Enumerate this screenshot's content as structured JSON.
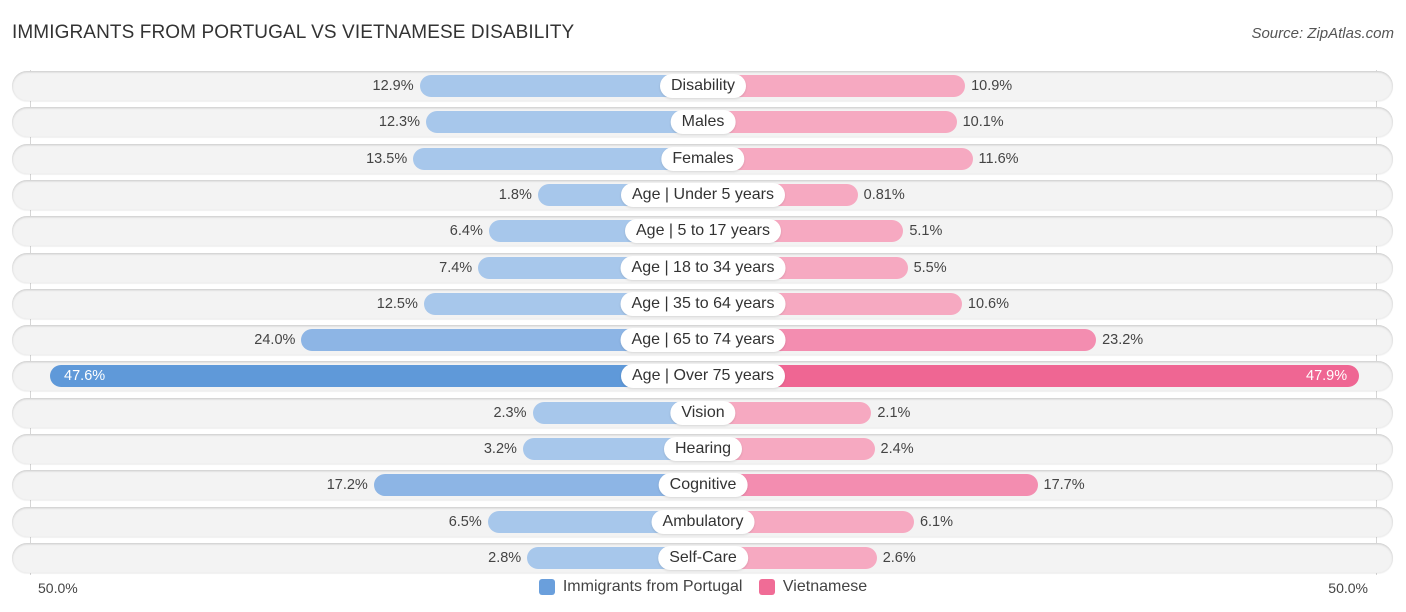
{
  "header": {
    "title": "IMMIGRANTS FROM PORTUGAL VS VIETNAMESE DISABILITY",
    "source": "Source: ZipAtlas.com"
  },
  "axis": {
    "left_label": "50.0%",
    "right_label": "50.0%"
  },
  "legend": [
    {
      "label": "Immigrants from Portugal",
      "color": "#6a9fdc"
    },
    {
      "label": "Vietnamese",
      "color": "#f06c96"
    }
  ],
  "colors": {
    "left_light": "#a7c7eb",
    "left_mid": "#8db5e5",
    "left_strong": "#5f99d9",
    "right_light": "#f6a9c1",
    "right_mid": "#f38db0",
    "right_strong": "#ef6693"
  },
  "chart_data": {
    "type": "bar",
    "orientation": "horizontal-diverging",
    "title": "IMMIGRANTS FROM PORTUGAL VS VIETNAMESE DISABILITY",
    "xlabel": "",
    "ylabel": "",
    "xlim": [
      0,
      50
    ],
    "x_tick_labels": [
      "50.0%",
      "50.0%"
    ],
    "legend_position": "bottom-center",
    "categories": [
      "Disability",
      "Males",
      "Females",
      "Age | Under 5 years",
      "Age | 5 to 17 years",
      "Age | 18 to 34 years",
      "Age | 35 to 64 years",
      "Age | 65 to 74 years",
      "Age | Over 75 years",
      "Vision",
      "Hearing",
      "Cognitive",
      "Ambulatory",
      "Self-Care"
    ],
    "series": [
      {
        "name": "Immigrants from Portugal",
        "side": "left",
        "values": [
          12.9,
          12.3,
          13.5,
          1.8,
          6.4,
          7.4,
          12.5,
          24.0,
          47.6,
          2.3,
          3.2,
          17.2,
          6.5,
          2.8
        ],
        "labels": [
          "12.9%",
          "12.3%",
          "13.5%",
          "1.8%",
          "6.4%",
          "7.4%",
          "12.5%",
          "24.0%",
          "47.6%",
          "2.3%",
          "3.2%",
          "17.2%",
          "6.5%",
          "2.8%"
        ]
      },
      {
        "name": "Vietnamese",
        "side": "right",
        "values": [
          10.9,
          10.1,
          11.6,
          0.81,
          5.1,
          5.5,
          10.6,
          23.2,
          47.9,
          2.1,
          2.4,
          17.7,
          6.1,
          2.6
        ],
        "labels": [
          "10.9%",
          "10.1%",
          "11.6%",
          "0.81%",
          "5.1%",
          "5.5%",
          "10.6%",
          "23.2%",
          "47.9%",
          "2.1%",
          "2.4%",
          "17.7%",
          "6.1%",
          "2.6%"
        ]
      }
    ]
  }
}
